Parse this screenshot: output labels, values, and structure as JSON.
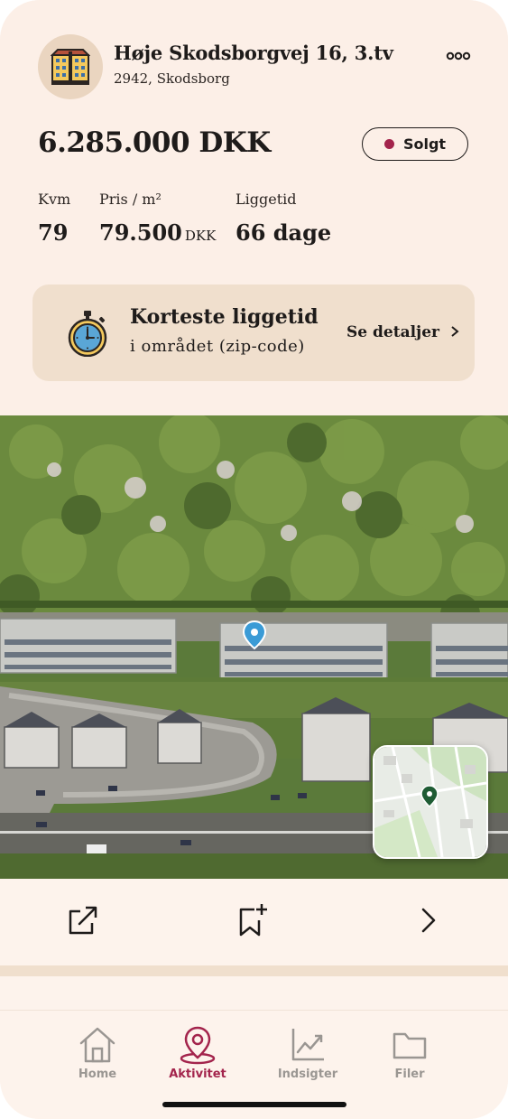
{
  "property": {
    "address": "Høje Skodsborgvej 16, 3.tv",
    "zip_city": "2942, Skodsborg",
    "price": "6.285.000 DKK",
    "status": "Solgt",
    "status_color": "#a3244c"
  },
  "stats": [
    {
      "label": "Kvm",
      "value": "79",
      "unit": ""
    },
    {
      "label": "Pris / m²",
      "value": "79.500",
      "unit": "DKK"
    },
    {
      "label": "Liggetid",
      "value": "66 dage",
      "unit": ""
    }
  ],
  "highlight": {
    "title": "Korteste liggetid",
    "subtitle": "i området (zip-code)",
    "link": "Se detaljer",
    "icon": "stopwatch-icon"
  },
  "actions": [
    "share-icon",
    "bookmark-add-icon",
    "chevron-right-icon"
  ],
  "nav": {
    "items": [
      {
        "label": "Home",
        "icon": "home-icon"
      },
      {
        "label": "Aktivitet",
        "icon": "location-pin-icon"
      },
      {
        "label": "Indsigter",
        "icon": "chart-icon"
      },
      {
        "label": "Filer",
        "icon": "folder-icon"
      }
    ],
    "active": "Aktivitet",
    "active_color": "#a3244c"
  }
}
